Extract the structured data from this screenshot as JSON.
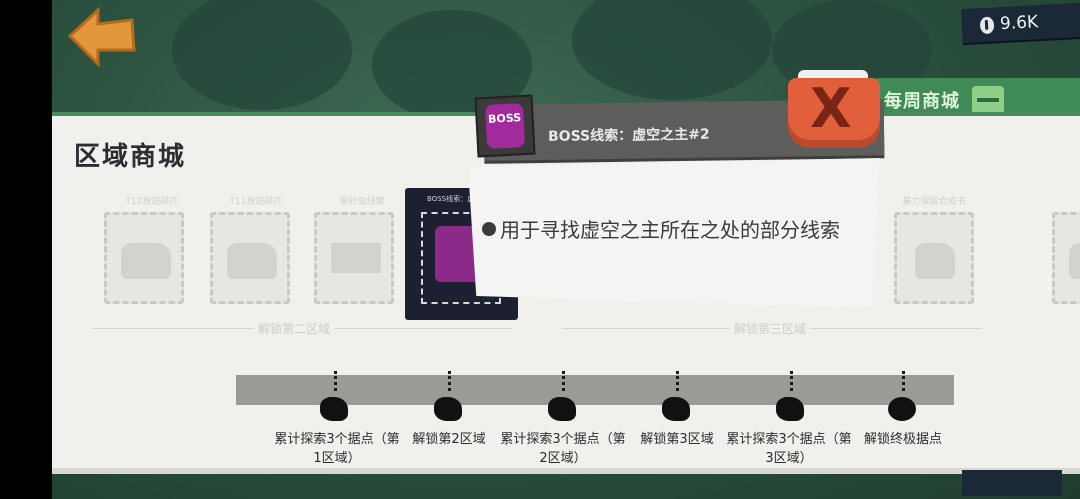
{
  "currency": {
    "amount": "9.6K",
    "icon": "coin-icon"
  },
  "weekly_shop": {
    "label": "每周商城",
    "icon": "shop-icon"
  },
  "panel": {
    "title": "区域商城"
  },
  "slots": [
    {
      "name": "T12放送碎片"
    },
    {
      "name": "T11放送碎片"
    },
    {
      "name": "雷砂虫线索"
    },
    {
      "name": "暴力保留合成书"
    }
  ],
  "selected_item": {
    "name": "BOSS线索：虚空之主#2",
    "art_label": "BOSS"
  },
  "dividers": [
    "解锁第二区域",
    "解锁第三区域"
  ],
  "milestones": [
    {
      "label": "累计探索3个据点（第1区域）"
    },
    {
      "label": "解锁第2区域"
    },
    {
      "label": "累计探索3个据点（第2区域）"
    },
    {
      "label": "解锁第3区域"
    },
    {
      "label": "累计探索3个据点（第3区域）"
    },
    {
      "label": "解锁终极据点"
    }
  ],
  "tooltip": {
    "title": "BOSS线索：虚空之主#2",
    "icon_label": "BOSS",
    "description": "用于寻找虚空之主所在之处的部分线索"
  },
  "close_button": {
    "symbol": "X"
  },
  "colors": {
    "accent_green": "#4a8b5d",
    "close_red": "#e15f3a",
    "boss_purple": "#a12a9c"
  }
}
